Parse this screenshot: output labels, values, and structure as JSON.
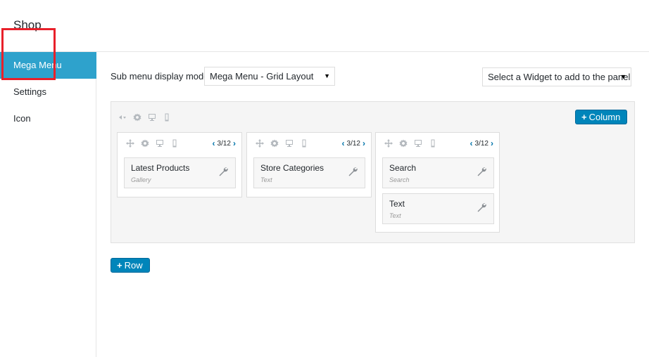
{
  "header": {
    "title": "Shop"
  },
  "sidebar": {
    "items": [
      {
        "label": "Mega Menu",
        "active": true
      },
      {
        "label": "Settings",
        "active": false
      },
      {
        "label": "Icon",
        "active": false
      }
    ]
  },
  "controls": {
    "mode_label": "Sub menu display mode",
    "mode_value": "Mega Menu - Grid Layout",
    "widget_select": "Select a Widget to add to the panel"
  },
  "buttons": {
    "column": "Column",
    "row": "Row"
  },
  "columns": [
    {
      "width": "3/12",
      "widgets": [
        {
          "title": "Latest Products",
          "subtitle": "Gallery"
        }
      ]
    },
    {
      "width": "3/12",
      "widgets": [
        {
          "title": "Store Categories",
          "subtitle": "Text"
        }
      ]
    },
    {
      "width": "3/12",
      "widgets": [
        {
          "title": "Search",
          "subtitle": "Search"
        },
        {
          "title": "Text",
          "subtitle": "Text"
        }
      ]
    }
  ],
  "colors": {
    "accent": "#2ea2cc",
    "button": "#0085ba",
    "highlight": "#e8202a"
  },
  "icons": [
    "move-icon",
    "gear-icon",
    "desktop-icon",
    "mobile-icon",
    "wrench-icon",
    "chevron-left-icon",
    "chevron-right-icon"
  ]
}
